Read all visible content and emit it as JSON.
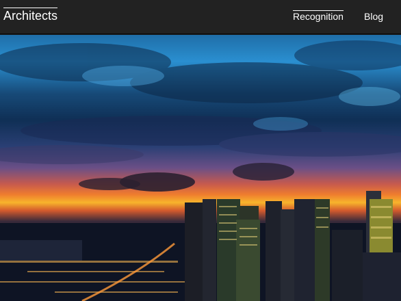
{
  "navbar": {
    "brand": "Architects",
    "links": [
      {
        "label": "Recognition"
      },
      {
        "label": "Blog"
      }
    ]
  },
  "hero": {
    "image": "city-skyline-sunset-photo"
  },
  "colors": {
    "navbar_bg": "#222222",
    "nav_text": "#ffffff"
  }
}
